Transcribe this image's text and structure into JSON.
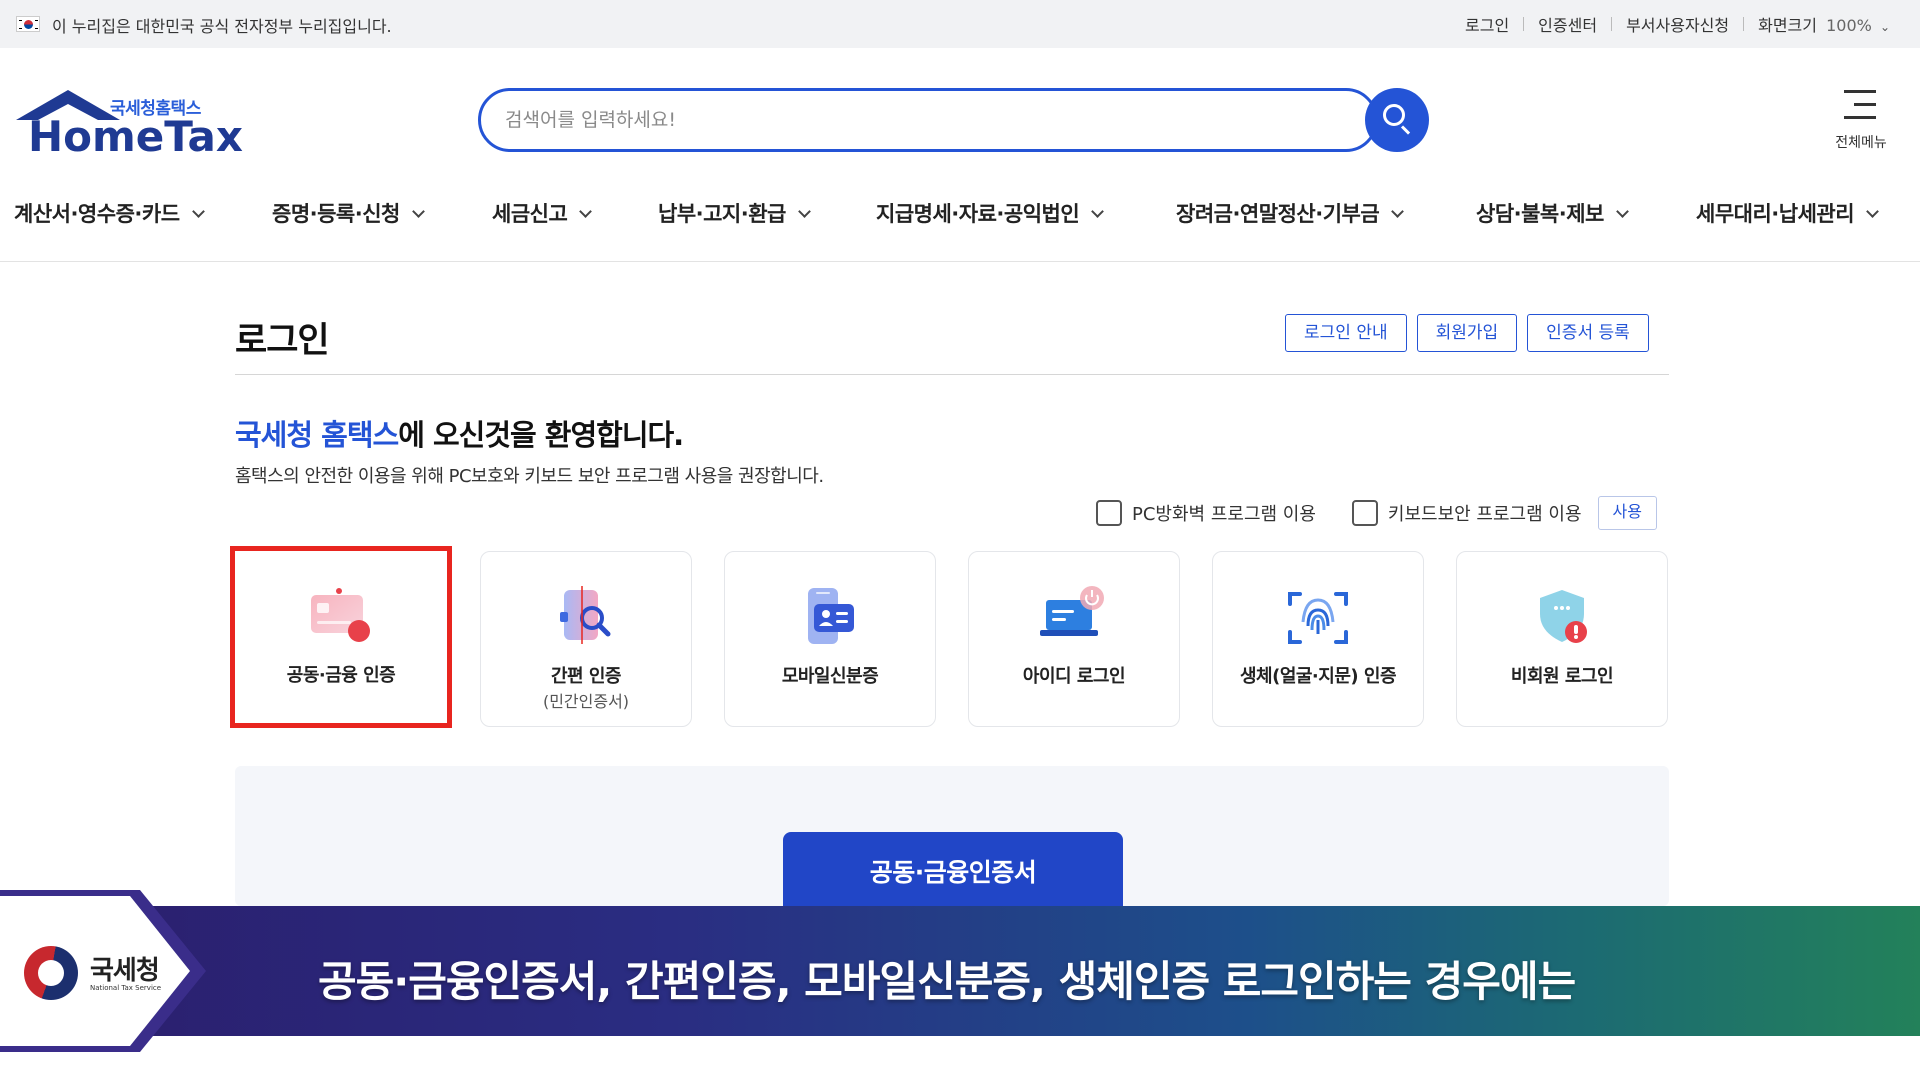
{
  "gov_bar": {
    "text": "이 누리집은 대한민국 공식 전자정부 누리집입니다.",
    "links": [
      "로그인",
      "인증센터",
      "부서사용자신청"
    ],
    "zoom_label": "화면크기",
    "zoom_value": "100%"
  },
  "header": {
    "logo_sub": "국세청홈택스",
    "logo_main": "HomeTax",
    "search_placeholder": "검색어를 입력하세요!",
    "all_menu_label": "전체메뉴"
  },
  "gnb": [
    "계산서·영수증·카드",
    "증명·등록·신청",
    "세금신고",
    "납부·고지·환급",
    "지급명세·자료·공익법인",
    "장려금·연말정산·기부금",
    "상담·불복·제보",
    "세무대리·납세관리"
  ],
  "login": {
    "title": "로그인",
    "top_buttons": [
      "로그인 안내",
      "회원가입",
      "인증서 등록"
    ],
    "welcome_highlight": "국세청 홈택스",
    "welcome_rest": "에 오신것을 환영합니다.",
    "welcome_sub": "홈택스의 안전한 이용을 위해 PC보호와 키보드 보안 프로그램 사용을 권장합니다.",
    "security": {
      "firewall_label": "PC방화벽 프로그램 이용",
      "keyboard_label": "키보드보안 프로그램 이용",
      "use_button": "사용"
    },
    "methods": [
      {
        "label": "공동·금융 인증",
        "sub": "",
        "icon": "cert-card-icon",
        "selected": true
      },
      {
        "label": "간편 인증",
        "sub": "(민간인증서)",
        "icon": "simple-auth-icon",
        "selected": false
      },
      {
        "label": "모바일신분증",
        "sub": "",
        "icon": "mobile-id-icon",
        "selected": false
      },
      {
        "label": "아이디 로그인",
        "sub": "",
        "icon": "id-login-icon",
        "selected": false
      },
      {
        "label": "생체(얼굴·지문) 인증",
        "sub": "",
        "icon": "biometric-icon",
        "selected": false
      },
      {
        "label": "비회원 로그인",
        "sub": "",
        "icon": "guest-shield-icon",
        "selected": false
      }
    ],
    "cert_button": "공동·금융인증서"
  },
  "caption": {
    "badge_name": "국세청",
    "badge_eng": "National Tax Service",
    "text": "공동·금융인증서, 간편인증, 모바일신분증, 생체인증 로그인하는 경우에는"
  },
  "colors": {
    "accent": "#2454d6",
    "highlight_border": "#e8251f",
    "cert_button": "#2146c7"
  }
}
